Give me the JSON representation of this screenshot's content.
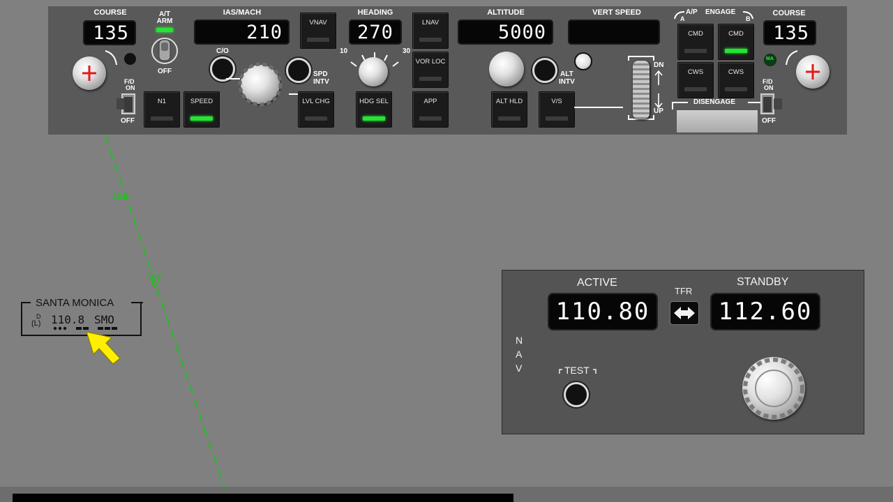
{
  "mcp": {
    "course_left": {
      "label": "COURSE",
      "value": "135"
    },
    "autothrottle": {
      "label_top": "A/T",
      "label_mid": "ARM",
      "label_off": "OFF"
    },
    "fd_left": {
      "label_top": "F/D",
      "label_on": "ON",
      "label_off": "OFF"
    },
    "ias_mach": {
      "label": "IAS/MACH",
      "value": "210",
      "co_label": "C/O",
      "spd_intv_l1": "SPD",
      "spd_intv_l2": "INTV"
    },
    "n1_button": {
      "label": "N1"
    },
    "speed_button": {
      "label": "SPEED"
    },
    "vnav_button": {
      "label": "VNAV"
    },
    "lvl_chg_button": {
      "label": "LVL CHG"
    },
    "heading": {
      "label": "HEADING",
      "value": "270",
      "bank_10": "10",
      "bank_30": "30"
    },
    "hdg_sel_button": {
      "label": "HDG SEL"
    },
    "lnav_button": {
      "label": "LNAV"
    },
    "vor_loc_button": {
      "label": "VOR LOC"
    },
    "app_button": {
      "label": "APP"
    },
    "altitude": {
      "label": "ALTITUDE",
      "value": "5000",
      "alt_intv_l1": "ALT",
      "alt_intv_l2": "INTV"
    },
    "alt_hld_button": {
      "label": "ALT HLD"
    },
    "vs_button": {
      "label": "V/S"
    },
    "vert_speed": {
      "label": "VERT SPEED",
      "value": ""
    },
    "wheel": {
      "label_dn": "DN",
      "label_up": "UP"
    },
    "ap_engage": {
      "label_ap": "A/P",
      "label_engage": "ENGAGE",
      "label_a": "A",
      "label_b": "B"
    },
    "cmd_a_button": {
      "label": "CMD"
    },
    "cmd_b_button": {
      "label": "CMD"
    },
    "cws_a_button": {
      "label": "CWS"
    },
    "cws_b_button": {
      "label": "CWS"
    },
    "disengage": {
      "label": "DISENGAGE"
    },
    "course_right": {
      "label": "COURSE",
      "value": "135"
    },
    "fd_right": {
      "label_top": "F/D",
      "label_on": "ON",
      "label_off": "OFF",
      "ma_label": "MA"
    }
  },
  "nav_radio": {
    "active_label": "ACTIVE",
    "active_freq": "110.80",
    "tfr_label": "TFR",
    "standby_label": "STANDBY",
    "standby_freq": "112.60",
    "side_label": [
      "N",
      "A",
      "V"
    ],
    "test_label": "TEST"
  },
  "map": {
    "vor_name": "SANTA MONICA",
    "vor_freq": "110.8",
    "vor_ident": "SMO",
    "vor_d": "D",
    "vor_l": "(L)",
    "radial_label": "324o"
  },
  "colors": {
    "lamp_on": "#27e334",
    "route": "#1fbf1f",
    "pointer": "#ffee00"
  }
}
